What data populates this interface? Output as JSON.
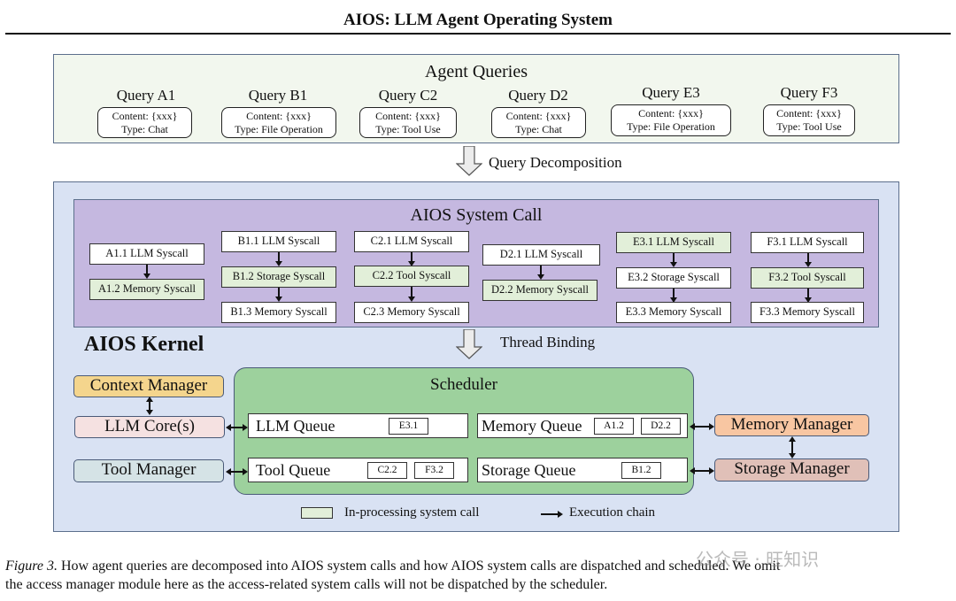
{
  "header": {
    "title": "AIOS: LLM Agent Operating System"
  },
  "agent_queries": {
    "title": "Agent Queries",
    "queries": [
      {
        "label": "Query A1",
        "content": "Content: {xxx}",
        "type": "Type: Chat"
      },
      {
        "label": "Query B1",
        "content": "Content: {xxx}",
        "type": "Type: File Operation"
      },
      {
        "label": "Query C2",
        "content": "Content: {xxx}",
        "type": "Type: Tool Use"
      },
      {
        "label": "Query D2",
        "content": "Content: {xxx}",
        "type": "Type: Chat"
      },
      {
        "label": "Query E3",
        "content": "Content: {xxx}",
        "type": "Type: File Operation"
      },
      {
        "label": "Query F3",
        "content": "Content: {xxx}",
        "type": "Type: Tool Use"
      }
    ]
  },
  "transitions": {
    "query_decomposition": "Query Decomposition",
    "thread_binding": "Thread Binding"
  },
  "system_call": {
    "title": "AIOS System Call",
    "chains": [
      {
        "agent": "A1",
        "calls": [
          {
            "label": "A1.1 LLM Syscall",
            "in_processing": false
          },
          {
            "label": "A1.2 Memory Syscall",
            "in_processing": true
          }
        ]
      },
      {
        "agent": "B1",
        "calls": [
          {
            "label": "B1.1 LLM Syscall",
            "in_processing": false
          },
          {
            "label": "B1.2 Storage Syscall",
            "in_processing": true
          },
          {
            "label": "B1.3 Memory Syscall",
            "in_processing": false
          }
        ]
      },
      {
        "agent": "C2",
        "calls": [
          {
            "label": "C2.1 LLM Syscall",
            "in_processing": false
          },
          {
            "label": "C2.2 Tool Syscall",
            "in_processing": true
          },
          {
            "label": "C2.3 Memory Syscall",
            "in_processing": false
          }
        ]
      },
      {
        "agent": "D2",
        "calls": [
          {
            "label": "D2.1 LLM Syscall",
            "in_processing": false
          },
          {
            "label": "D2.2 Memory Syscall",
            "in_processing": true
          }
        ]
      },
      {
        "agent": "E3",
        "calls": [
          {
            "label": "E3.1 LLM Syscall",
            "in_processing": true
          },
          {
            "label": "E3.2 Storage Syscall",
            "in_processing": false
          },
          {
            "label": "E3.3 Memory Syscall",
            "in_processing": false
          }
        ]
      },
      {
        "agent": "F3",
        "calls": [
          {
            "label": "F3.1 LLM Syscall",
            "in_processing": false
          },
          {
            "label": "F3.2 Tool Syscall",
            "in_processing": true
          },
          {
            "label": "F3.3 Memory Syscall",
            "in_processing": false
          }
        ]
      }
    ]
  },
  "kernel": {
    "title": "AIOS Kernel",
    "context_manager": "Context Manager",
    "llm_cores": "LLM Core(s)",
    "tool_manager": "Tool Manager",
    "memory_manager": "Memory Manager",
    "storage_manager": "Storage Manager",
    "scheduler": {
      "title": "Scheduler",
      "llm_queue": {
        "label": "LLM Queue",
        "items": [
          "E3.1"
        ]
      },
      "memory_queue": {
        "label": "Memory Queue",
        "items": [
          "A1.2",
          "D2.2"
        ]
      },
      "tool_queue": {
        "label": "Tool Queue",
        "items": [
          "C2.2",
          "F3.2"
        ]
      },
      "storage_queue": {
        "label": "Storage Queue",
        "items": [
          "B1.2"
        ]
      }
    },
    "colors": {
      "context_manager": "#f4d58d",
      "llm_cores": "#f5e1e1",
      "tool_manager": "#d5e3e6",
      "memory_manager": "#f8c6a2",
      "storage_manager": "#e0c0b8",
      "scheduler": "#9dd19d",
      "in_processing": "#e2efd9"
    }
  },
  "legend": {
    "in_processing": "In-processing system call",
    "execution_chain": "Execution chain"
  },
  "caption": {
    "figure_label": "Figure 3.",
    "line1": " How agent queries are decomposed into AIOS system calls and how AIOS system calls are dispatched and scheduled. We omit",
    "line2": "the access manager module here as the access-related system calls will not be dispatched by the scheduler."
  },
  "watermark": "公众号 · 旺知识"
}
